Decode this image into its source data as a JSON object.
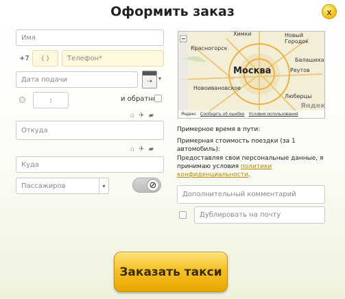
{
  "dialog": {
    "title": "Оформить заказ",
    "close_label": "x"
  },
  "form": {
    "name_placeholder": "Имя",
    "phone_prefix": "+7",
    "phone_code": "(     )",
    "phone_placeholder": "Телефон*",
    "date_placeholder": "Дата подачи",
    "time_value": ":",
    "return_label": "и обратно",
    "from_placeholder": "Откуда",
    "to_placeholder": "Куда",
    "passengers_placeholder": "Пассажиров",
    "comment_placeholder": "Дополнительный комментарий",
    "email_placeholder": "Дублировать на почту"
  },
  "map": {
    "labels": {
      "khimki": "Химки",
      "lyubertsy_top": "Новый Городок",
      "krasnogorsk": "Красногорск",
      "balashikha": "Балашиха",
      "moscow": "Москва",
      "reutov": "Реутов",
      "novoivanovskoe": "Новоивановское",
      "lyubertsy": "Люберцы",
      "yandex_logo": "Яндекс",
      "footer_yandex": "Яндекс",
      "footer_error": "Сообщить об ошибке",
      "footer_terms": "Условия использования"
    }
  },
  "info": {
    "time_label": "Примерное время в пути:",
    "cost_label": "Примерная стоимость поездки (за 1 автомобиль):",
    "consent_text": "Предоставляя свои персональные данные, я принимаю условия",
    "consent_link": "политики конфиденциальности",
    "consent_end": "."
  },
  "actions": {
    "order_button": "Заказать такси"
  },
  "colors": {
    "accent": "#f6c126",
    "phone_field_bg": "#fff8dc",
    "link": "#b58a00"
  }
}
